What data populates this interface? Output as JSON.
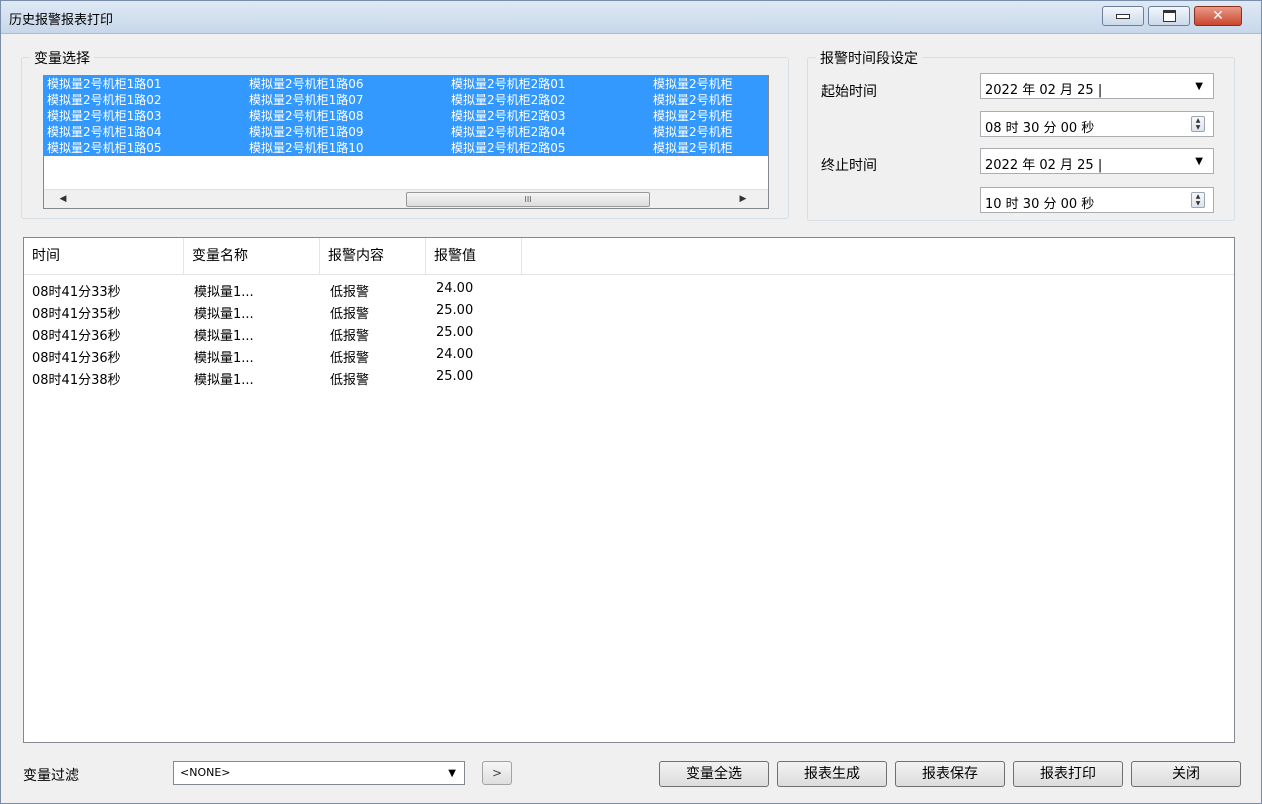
{
  "window": {
    "title": "历史报警报表打印"
  },
  "variable_group": {
    "label": "变量选择",
    "items": [
      [
        "模拟量2号机柜1路01",
        "模拟量2号机柜1路02",
        "模拟量2号机柜1路03",
        "模拟量2号机柜1路04",
        "模拟量2号机柜1路05"
      ],
      [
        "模拟量2号机柜1路06",
        "模拟量2号机柜1路07",
        "模拟量2号机柜1路08",
        "模拟量2号机柜1路09",
        "模拟量2号机柜1路10"
      ],
      [
        "模拟量2号机柜2路01",
        "模拟量2号机柜2路02",
        "模拟量2号机柜2路03",
        "模拟量2号机柜2路04",
        "模拟量2号机柜2路05"
      ],
      [
        "模拟量2号机柜",
        "模拟量2号机柜",
        "模拟量2号机柜",
        "模拟量2号机柜",
        "模拟量2号机柜"
      ]
    ],
    "scroll_thumb": "III"
  },
  "time_group": {
    "label": "报警时间段设定",
    "start_label": "起始时间",
    "end_label": "终止时间",
    "start_date": "2022 年 02 月 25 |",
    "start_time": "08 时 30 分 00 秒",
    "end_date": "2022 年 02 月 25 |",
    "end_time": "10 时 30 分 00 秒"
  },
  "table": {
    "headers": [
      "时间",
      "变量名称",
      "报警内容",
      "报警值"
    ],
    "rows": [
      [
        "08时41分33秒",
        "模拟量1...",
        "低报警",
        "24.00"
      ],
      [
        "08时41分35秒",
        "模拟量1...",
        "低报警",
        "25.00"
      ],
      [
        "08时41分36秒",
        "模拟量1...",
        "低报警",
        "25.00"
      ],
      [
        "08时41分36秒",
        "模拟量1...",
        "低报警",
        "24.00"
      ],
      [
        "08时41分38秒",
        "模拟量1...",
        "低报警",
        "25.00"
      ]
    ]
  },
  "footer": {
    "filter_label": "变量过滤",
    "filter_value": "<NONE>",
    "nav_label": ">",
    "buttons": [
      "变量全选",
      "报表生成",
      "报表保存",
      "报表打印",
      "关闭"
    ]
  }
}
